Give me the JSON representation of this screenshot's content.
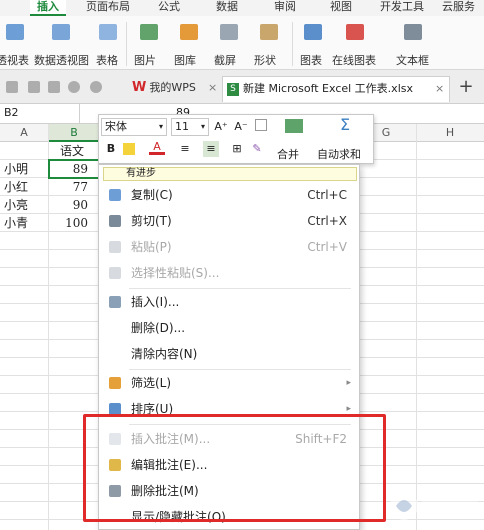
{
  "ribbon": {
    "tabs": [
      "插入",
      "页面布局",
      "公式",
      "数据",
      "审阅",
      "视图",
      "开发工具",
      "云服务"
    ],
    "active_tab": "插入",
    "commands": [
      {
        "label": "透视表",
        "icon": "pivot-table-icon"
      },
      {
        "label": "数据透视图",
        "icon": "pivot-chart-icon"
      },
      {
        "label": "表格",
        "icon": "table-icon"
      },
      {
        "label": "图片",
        "icon": "picture-icon"
      },
      {
        "label": "图库",
        "icon": "gallery-icon"
      },
      {
        "label": "截屏",
        "icon": "screenshot-icon"
      },
      {
        "label": "形状",
        "icon": "shapes-icon"
      },
      {
        "label": "图表",
        "icon": "chart-icon"
      },
      {
        "label": "在线图表",
        "icon": "online-chart-icon"
      },
      {
        "label": "文本框",
        "icon": "textbox-icon"
      }
    ],
    "accent": "#1e8a3c"
  },
  "doc_tabs": {
    "wps": "我的WPS",
    "excel": "新建 Microsoft Excel 工作表.xlsx",
    "close_glyph": "×",
    "new_glyph": "+"
  },
  "formula_bar": {
    "name_box": "B2",
    "value": "89"
  },
  "grid": {
    "columns": [
      "A",
      "B",
      "C",
      "D",
      "E",
      "F",
      "G",
      "H"
    ],
    "active_column": "B",
    "header": "语文",
    "rows": [
      {
        "name": "小明",
        "score": "89"
      },
      {
        "name": "小红",
        "score": "77"
      },
      {
        "name": "小亮",
        "score": "90"
      },
      {
        "name": "小青",
        "score": "100"
      }
    ]
  },
  "mini_toolbar": {
    "font_name": "宋体",
    "font_size": "11",
    "bold": "B",
    "merge_label": "合并",
    "autosum_label": "自动求和",
    "sum_glyph": "Σ",
    "grow_font": "A⁺",
    "shrink_font": "A⁻"
  },
  "context_menu": {
    "edit_preview": "有进步",
    "items": [
      {
        "label": "复制(C)",
        "shortcut": "Ctrl+C",
        "icon": "copy-icon",
        "disabled": false
      },
      {
        "label": "剪切(T)",
        "shortcut": "Ctrl+X",
        "icon": "cut-icon",
        "disabled": false
      },
      {
        "label": "粘贴(P)",
        "shortcut": "Ctrl+V",
        "icon": "paste-icon",
        "disabled": true
      },
      {
        "label": "选择性粘贴(S)...",
        "shortcut": "",
        "icon": "paste-special-icon",
        "disabled": true
      },
      {
        "label": "插入(I)...",
        "shortcut": "",
        "icon": "insert-icon",
        "disabled": false
      },
      {
        "label": "删除(D)...",
        "shortcut": "",
        "icon": "",
        "disabled": false
      },
      {
        "label": "清除内容(N)",
        "shortcut": "",
        "icon": "",
        "disabled": false
      },
      {
        "label": "筛选(L)",
        "shortcut": "",
        "icon": "filter-icon",
        "disabled": false,
        "submenu": true
      },
      {
        "label": "排序(U)",
        "shortcut": "",
        "icon": "sort-icon",
        "disabled": false,
        "submenu": true
      },
      {
        "label": "插入批注(M)...",
        "shortcut": "Shift+F2",
        "icon": "insert-comment-icon",
        "disabled": true
      },
      {
        "label": "编辑批注(E)...",
        "shortcut": "",
        "icon": "edit-comment-icon",
        "disabled": false
      },
      {
        "label": "删除批注(M)",
        "shortcut": "",
        "icon": "delete-comment-icon",
        "disabled": false
      },
      {
        "label": "显示/隐藏批注(O)",
        "shortcut": "",
        "icon": "",
        "disabled": false
      }
    ],
    "submenu_glyph": "▸"
  },
  "colors": {
    "highlight_border": "#e02a2a",
    "selection": "#1e8a3c"
  }
}
